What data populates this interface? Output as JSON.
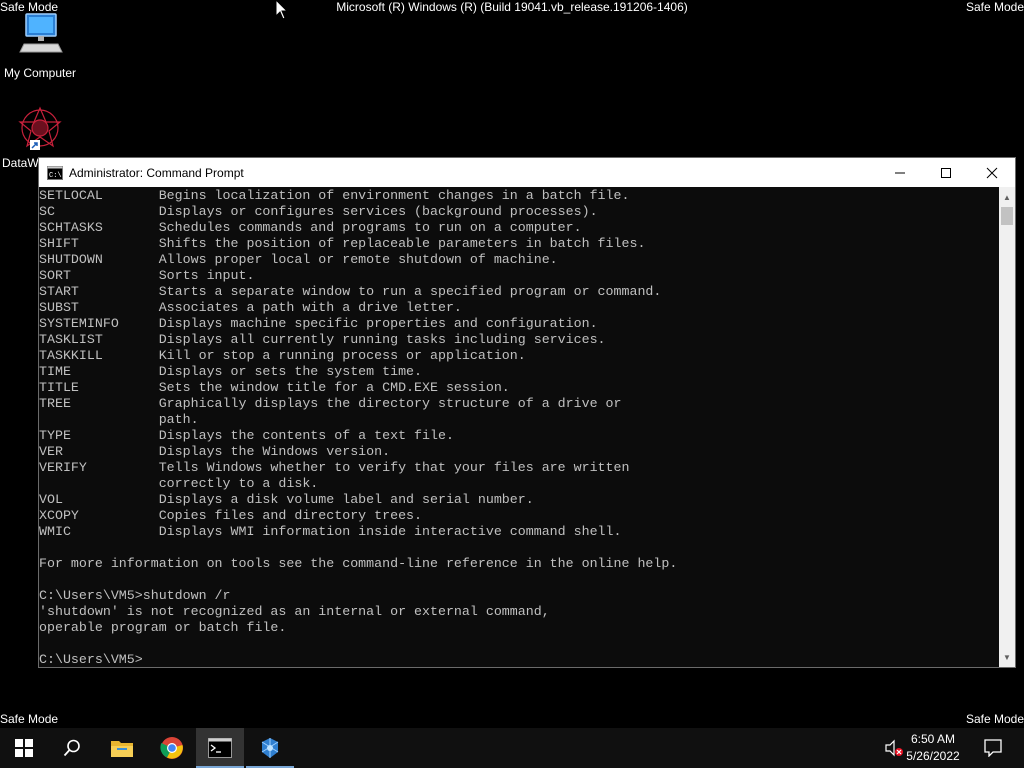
{
  "desktop": {
    "safe_mode_label": "Safe Mode",
    "build_text": "Microsoft (R) Windows (R) (Build 19041.vb_release.191206-1406)",
    "icons": [
      {
        "label": "My Computer"
      },
      {
        "label": "DataW"
      }
    ]
  },
  "window": {
    "title": "Administrator: Command Prompt",
    "console_text": "SETLOCAL       Begins localization of environment changes in a batch file.\nSC             Displays or configures services (background processes).\nSCHTASKS       Schedules commands and programs to run on a computer.\nSHIFT          Shifts the position of replaceable parameters in batch files.\nSHUTDOWN       Allows proper local or remote shutdown of machine.\nSORT           Sorts input.\nSTART          Starts a separate window to run a specified program or command.\nSUBST          Associates a path with a drive letter.\nSYSTEMINFO     Displays machine specific properties and configuration.\nTASKLIST       Displays all currently running tasks including services.\nTASKKILL       Kill or stop a running process or application.\nTIME           Displays or sets the system time.\nTITLE          Sets the window title for a CMD.EXE session.\nTREE           Graphically displays the directory structure of a drive or\n               path.\nTYPE           Displays the contents of a text file.\nVER            Displays the Windows version.\nVERIFY         Tells Windows whether to verify that your files are written\n               correctly to a disk.\nVOL            Displays a disk volume label and serial number.\nXCOPY          Copies files and directory trees.\nWMIC           Displays WMI information inside interactive command shell.\n\nFor more information on tools see the command-line reference in the online help.\n\nC:\\Users\\VM5>shutdown /r\n'shutdown' is not recognized as an internal or external command,\noperable program or batch file.\n\nC:\\Users\\VM5>"
  },
  "taskbar": {
    "apps": [
      {
        "name": "start-icon"
      },
      {
        "name": "search-icon"
      },
      {
        "name": "file-explorer-icon"
      },
      {
        "name": "chrome-icon"
      },
      {
        "name": "command-prompt-icon"
      },
      {
        "name": "datawrapper-icon"
      }
    ],
    "time": "6:50 AM",
    "date": "5/26/2022"
  },
  "colors": {
    "console_bg": "#0c0c0c",
    "console_fg": "#c0c0c0",
    "taskbar_bg": "#101010",
    "active_indicator": "#7aa7d6"
  }
}
